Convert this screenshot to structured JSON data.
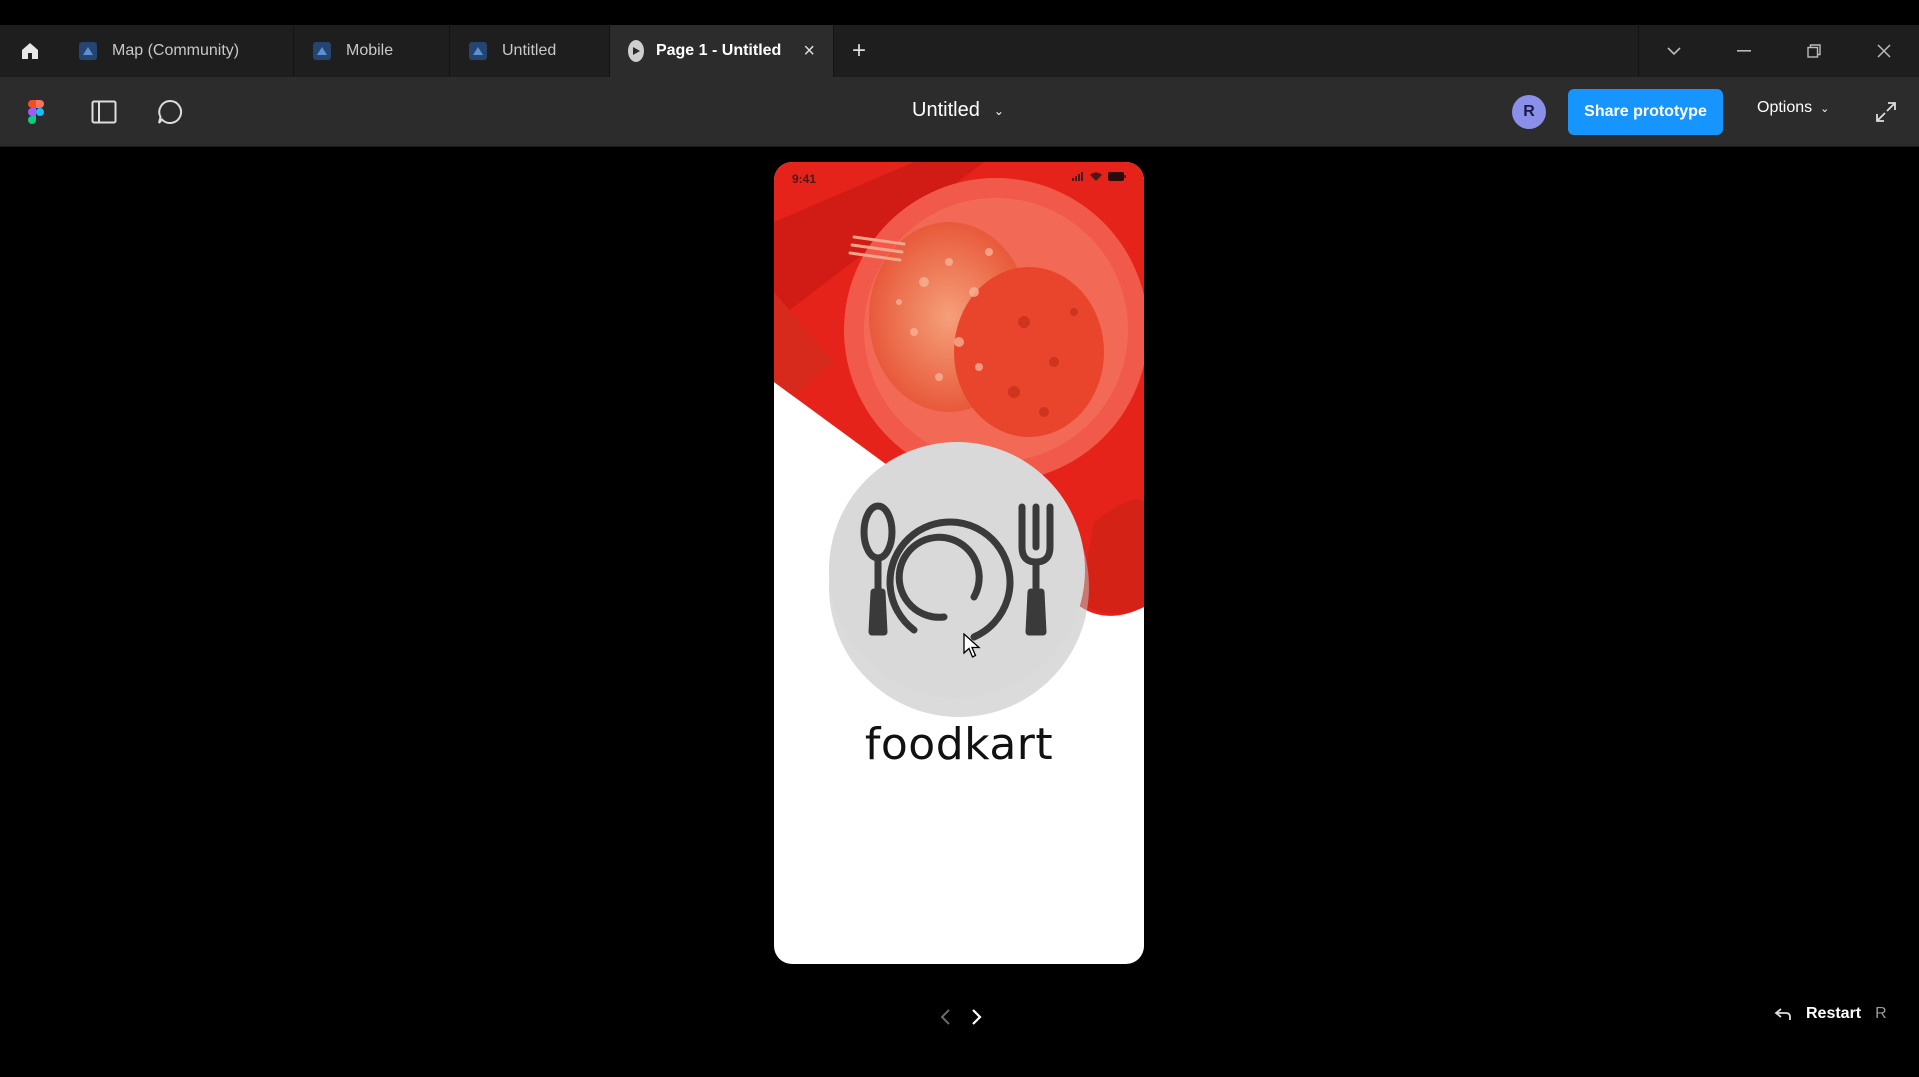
{
  "tabs": [
    {
      "label": "Map (Community)",
      "icon": "figma-file-icon"
    },
    {
      "label": "Mobile",
      "icon": "figma-file-icon"
    },
    {
      "label": "Untitled",
      "icon": "figma-file-icon"
    },
    {
      "label": "Page 1 - Untitled",
      "icon": "play-icon",
      "active": true
    }
  ],
  "toolbar": {
    "file_title": "Untitled",
    "avatar_initial": "R",
    "share_label": "Share prototype",
    "options_label": "Options"
  },
  "prototype": {
    "status_time": "9:41",
    "brand_name": "foodkart"
  },
  "footer": {
    "restart_label": "Restart",
    "restart_key": "R"
  },
  "colors": {
    "accent": "#1795ff",
    "brand_red": "#e5231b",
    "plate_gray": "#d9d9d9"
  }
}
